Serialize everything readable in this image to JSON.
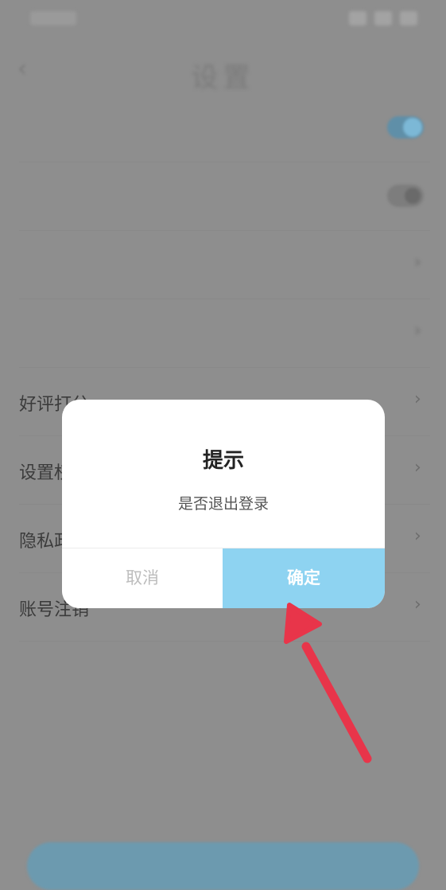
{
  "status_bar": {
    "time": "",
    "icons": [
      "signal-icon",
      "wifi-icon",
      "battery-icon"
    ]
  },
  "header": {
    "title": "设置"
  },
  "settings": {
    "items": [
      {
        "label": "",
        "control": "toggle-on"
      },
      {
        "label": "",
        "control": "toggle-off"
      },
      {
        "label": "",
        "control": "chevron"
      },
      {
        "label": "",
        "control": "value-chevron",
        "value": ""
      },
      {
        "label": "好评打分",
        "control": "chevron"
      },
      {
        "label": "设置权限",
        "control": "chevron"
      },
      {
        "label": "隐私政策",
        "control": "chevron"
      },
      {
        "label": "账号注销",
        "control": "chevron"
      },
      {
        "label": "",
        "control": "value",
        "value": ""
      }
    ]
  },
  "dialog": {
    "title": "提示",
    "message": "是否退出登录",
    "cancel_label": "取消",
    "confirm_label": "确定"
  },
  "colors": {
    "overlay": "#8e8e8e",
    "confirm_bg": "#8ed3f1",
    "annotation_arrow": "#e8354a"
  }
}
